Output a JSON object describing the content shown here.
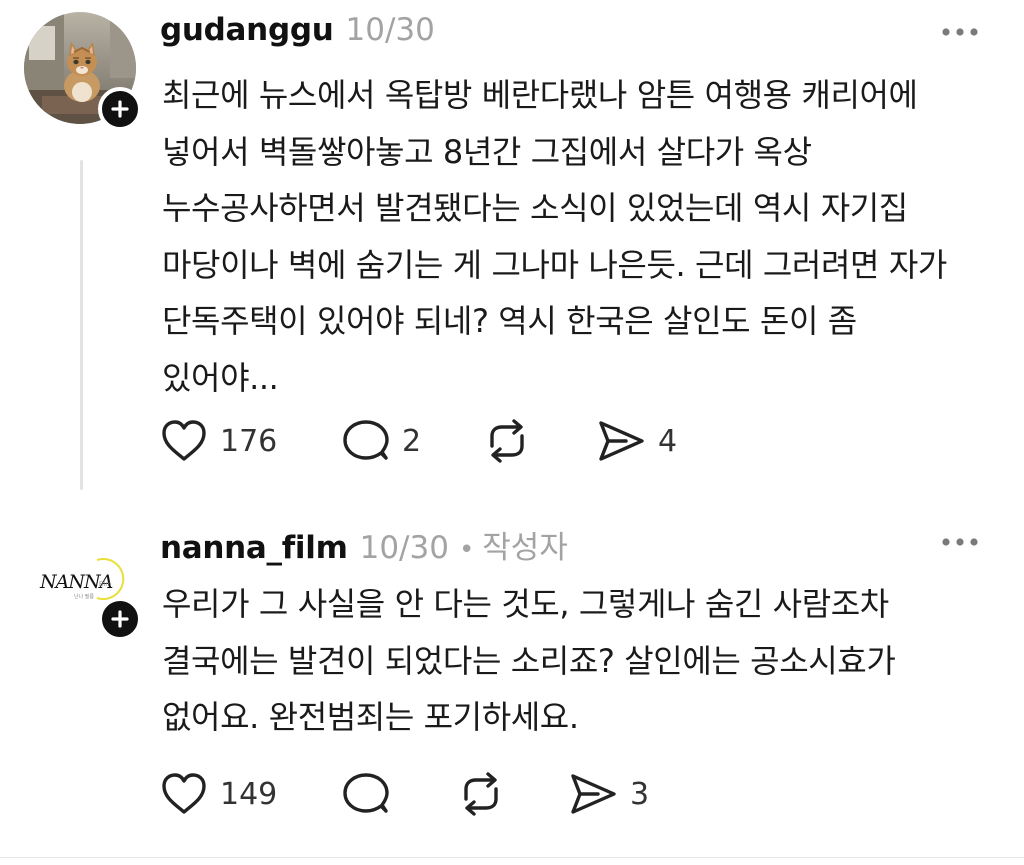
{
  "posts": [
    {
      "username": "gudanggu",
      "timestamp": "10/30",
      "avatar_icon": "cat-photo-avatar",
      "text_lines": [
        "최근에 뉴스에서 옥탑방 베란다랬나 암튼 여행용 캐리어에",
        "넣어서 벽돌쌓아놓고 8년간 그집에서 살다가 옥상",
        "누수공사하면서 발견됐다는 소식이 있었는데 역시 자기집",
        "마당이나 벽에 숨기는 게 그나마 나은듯. 근데 그러려면 자가",
        "단독주택이 있어야 되네? 역시 한국은 살인도 돈이 좀",
        "있어야..."
      ],
      "likes": "176",
      "replies": "2",
      "reposts": "",
      "shares": "4"
    },
    {
      "username": "nanna_film",
      "timestamp": "10/30",
      "separator": "•",
      "author_tag": "작성자",
      "avatar_logo": {
        "wordmark": "NANNA",
        "sub": "Film",
        "small": "난나 필름"
      },
      "text_lines": [
        "우리가 그 사실을 안 다는 것도, 그렇게나 숨긴 사람조차",
        "결국에는 발견이 되었다는 소리죠? 살인에는 공소시효가",
        "없어요. 완전범죄는 포기하세요."
      ],
      "likes": "149",
      "replies": "",
      "reposts": "",
      "shares": "3"
    }
  ],
  "colors": {
    "text": "#1a1a1a",
    "muted": "#a3a3a3",
    "icon": "#222222",
    "thread_line": "#e3e3e3",
    "logo_accent": "#e8df3a"
  }
}
